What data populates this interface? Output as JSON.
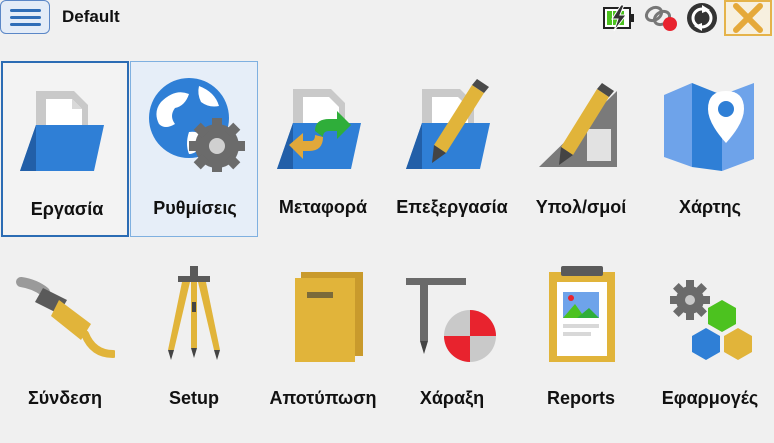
{
  "header": {
    "title": "Default",
    "menu_icon": "hamburger-menu-icon",
    "status_icons": [
      "battery-charging-icon",
      "link-offline-icon",
      "sync-icon"
    ],
    "close_icon": "close-icon"
  },
  "tiles": [
    {
      "label": "Εργασία",
      "icon": "folder-job-icon",
      "state": "selected"
    },
    {
      "label": "Ρυθμίσεις",
      "icon": "globe-settings-icon",
      "state": "hover"
    },
    {
      "label": "Μεταφορά",
      "icon": "folder-transfer-icon",
      "state": "normal"
    },
    {
      "label": "Επεξεργασία",
      "icon": "folder-edit-icon",
      "state": "normal"
    },
    {
      "label": "Υπολ/σμοί",
      "icon": "calculator-pencil-icon",
      "state": "normal"
    },
    {
      "label": "Χάρτης",
      "icon": "map-pin-icon",
      "state": "normal"
    },
    {
      "label": "Σύνδεση",
      "icon": "cable-plug-icon",
      "state": "normal"
    },
    {
      "label": "Setup",
      "icon": "tripod-icon",
      "state": "normal"
    },
    {
      "label": "Αποτύπωση",
      "icon": "survey-book-icon",
      "state": "normal"
    },
    {
      "label": "Χάραξη",
      "icon": "stakeout-icon",
      "state": "normal"
    },
    {
      "label": "Reports",
      "icon": "clipboard-report-icon",
      "state": "normal"
    },
    {
      "label": "Εφαρμογές",
      "icon": "apps-hex-icon",
      "state": "normal"
    }
  ],
  "colors": {
    "accent": "#2b6cb4",
    "folder_blue": "#2f7fd6",
    "yellow": "#e1b43a",
    "red": "#e8232e",
    "green": "#4cc21f"
  }
}
